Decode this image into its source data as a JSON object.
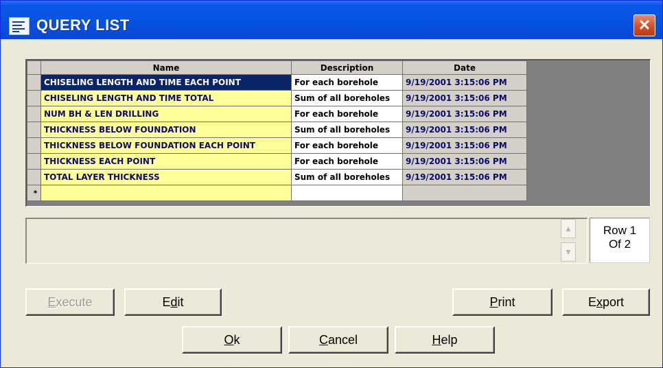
{
  "window": {
    "title": "QUERY LIST",
    "close_glyph": "✕"
  },
  "grid": {
    "columns": [
      "Name",
      "Description",
      "Date"
    ],
    "rows": [
      {
        "name": "CHISELING LENGTH AND TIME EACH POINT",
        "description": "For each borehole",
        "date": "9/19/2001 3:15:06 PM",
        "active": true
      },
      {
        "name": "CHISELING LENGTH AND TIME TOTAL",
        "description": "Sum of all boreholes",
        "date": "9/19/2001 3:15:06 PM"
      },
      {
        "name": "NUM BH & LEN DRILLING",
        "description": "For each borehole",
        "date": "9/19/2001 3:15:06 PM"
      },
      {
        "name": "THICKNESS BELOW FOUNDATION",
        "description": "Sum of all boreholes",
        "date": "9/19/2001 3:15:06 PM"
      },
      {
        "name": "THICKNESS BELOW FOUNDATION EACH POINT",
        "description": "For each borehole",
        "date": "9/19/2001 3:15:06 PM"
      },
      {
        "name": "THICKNESS EACH POINT",
        "description": "For each borehole",
        "date": "9/19/2001 3:15:06 PM"
      },
      {
        "name": "TOTAL LAYER THICKNESS",
        "description": "Sum of all boreholes",
        "date": "9/19/2001 3:15:06 PM"
      }
    ],
    "new_row_marker": "*"
  },
  "memo": {
    "text": ""
  },
  "record": {
    "line1": "Row 1",
    "line2": "Of 2"
  },
  "buttons": {
    "execute": {
      "pre": "",
      "key": "E",
      "post": "xecute",
      "enabled": false
    },
    "edit": {
      "pre": "E",
      "key": "d",
      "post": "it"
    },
    "print": {
      "pre": "",
      "key": "P",
      "post": "rint"
    },
    "export": {
      "pre": "E",
      "key": "x",
      "post": "port"
    },
    "ok": {
      "pre": "",
      "key": "O",
      "post": "k"
    },
    "cancel": {
      "pre": "",
      "key": "C",
      "post": "ancel"
    },
    "help": {
      "pre": "",
      "key": "H",
      "post": "elp"
    }
  },
  "colors": {
    "title_bar": "#0652e0",
    "name_cell": "#ffff99",
    "selection": "#0a246a",
    "close_button": "#d24a22"
  }
}
